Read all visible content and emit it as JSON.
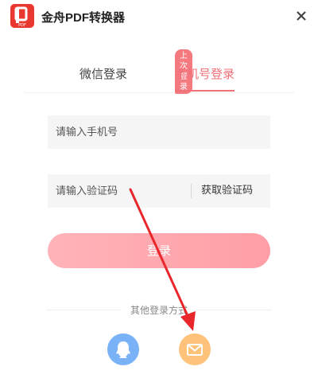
{
  "header": {
    "logo_text": "PDF",
    "title": "金舟PDF转换器"
  },
  "tabs": [
    {
      "label": "微信登录",
      "active": false
    },
    {
      "label": "手机号登录",
      "active": true
    }
  ],
  "last_login_badge": "上次登录",
  "phone_input": {
    "placeholder": "请输入手机号",
    "value": ""
  },
  "code_input": {
    "placeholder": "请输入验证码",
    "value": ""
  },
  "get_code_label": "获取验证码",
  "login_button": "登录",
  "other_methods_label": "其他登录方式",
  "colors": {
    "accent": "#f07078",
    "logo": "#e8382f",
    "qq": "#7ab2f7",
    "mail": "#ffc27a",
    "annotation_arrow": "#e8262b"
  },
  "other_methods": [
    {
      "icon": "qq-icon"
    },
    {
      "icon": "mail-icon"
    }
  ]
}
